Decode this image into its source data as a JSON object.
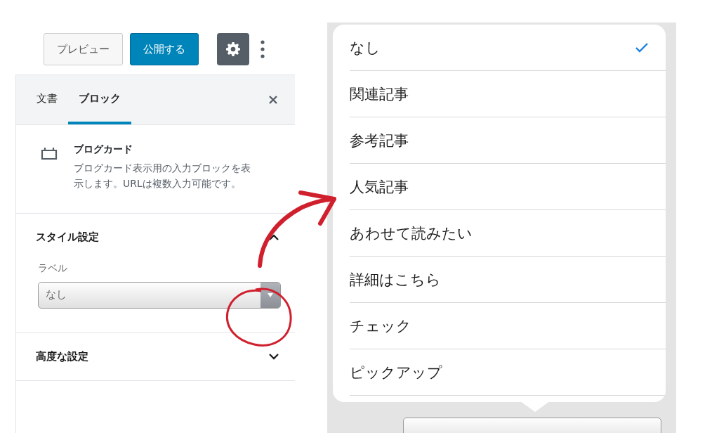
{
  "toolbar": {
    "preview_button": "プレビュー",
    "publish_button": "公開する",
    "settings_active": true
  },
  "sidebar": {
    "tabs": [
      {
        "label": "文書",
        "selected": false
      },
      {
        "label": "ブロック",
        "selected": true
      }
    ],
    "block": {
      "title": "ブログカード",
      "description": "ブログカード表示用の入力ブロックを表示します。URLは複数入力可能です。"
    },
    "panels": [
      {
        "title": "スタイル設定",
        "expanded": true,
        "field": {
          "label": "ラベル",
          "value": "なし"
        }
      },
      {
        "title": "高度な設定",
        "expanded": false
      }
    ]
  },
  "dropdown": {
    "options": [
      {
        "label": "なし",
        "selected": true
      },
      {
        "label": "関連記事",
        "selected": false
      },
      {
        "label": "参考記事",
        "selected": false
      },
      {
        "label": "人気記事",
        "selected": false
      },
      {
        "label": "あわせて読みたい",
        "selected": false
      },
      {
        "label": "詳細はこちら",
        "selected": false
      },
      {
        "label": "チェック",
        "selected": false
      },
      {
        "label": "ピックアップ",
        "selected": false
      }
    ]
  }
}
